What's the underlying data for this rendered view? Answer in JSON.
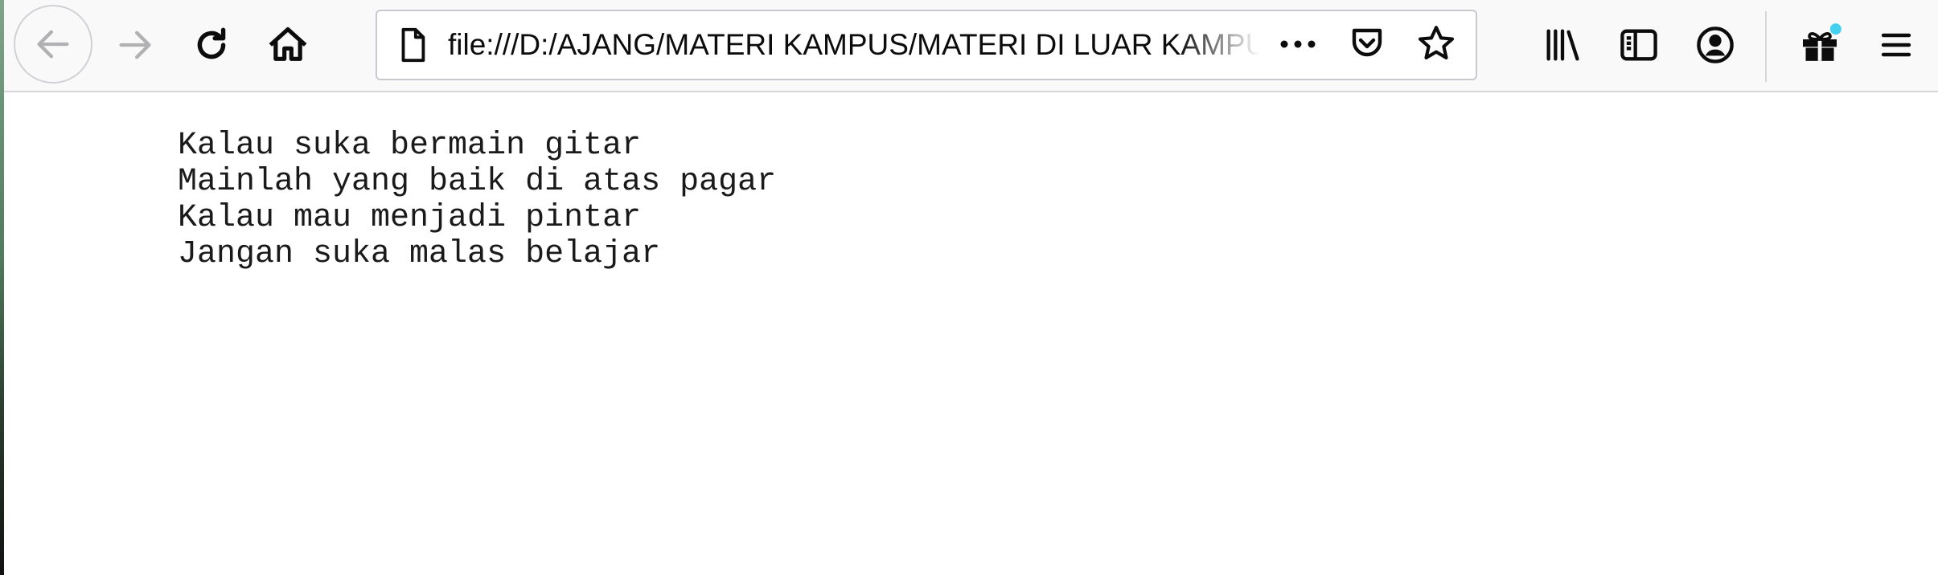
{
  "browser": {
    "url": "file:///D:/AJANG/MATERI KAMPUS/MATERI DI LUAR KAMPUS/pantun.html"
  },
  "icons": {
    "back": "arrow-left-icon",
    "forward": "arrow-right-icon",
    "reload": "reload-icon",
    "home": "home-icon",
    "page": "page-icon",
    "more": "ellipsis-icon",
    "pocket": "pocket-icon",
    "bookmark": "star-icon",
    "library": "library-icon",
    "sidebar": "sidebar-icon",
    "account": "account-icon",
    "gift": "gift-icon",
    "menu": "hamburger-menu-icon"
  },
  "colors": {
    "icon": "#0c0c0d",
    "disabled_icon": "#b1b1b3",
    "notification_dot": "#45d0f0"
  },
  "content": {
    "lines": [
      "Kalau suka bermain gitar",
      "Mainlah yang baik di atas pagar",
      "Kalau mau menjadi pintar",
      "Jangan suka malas belajar"
    ]
  }
}
